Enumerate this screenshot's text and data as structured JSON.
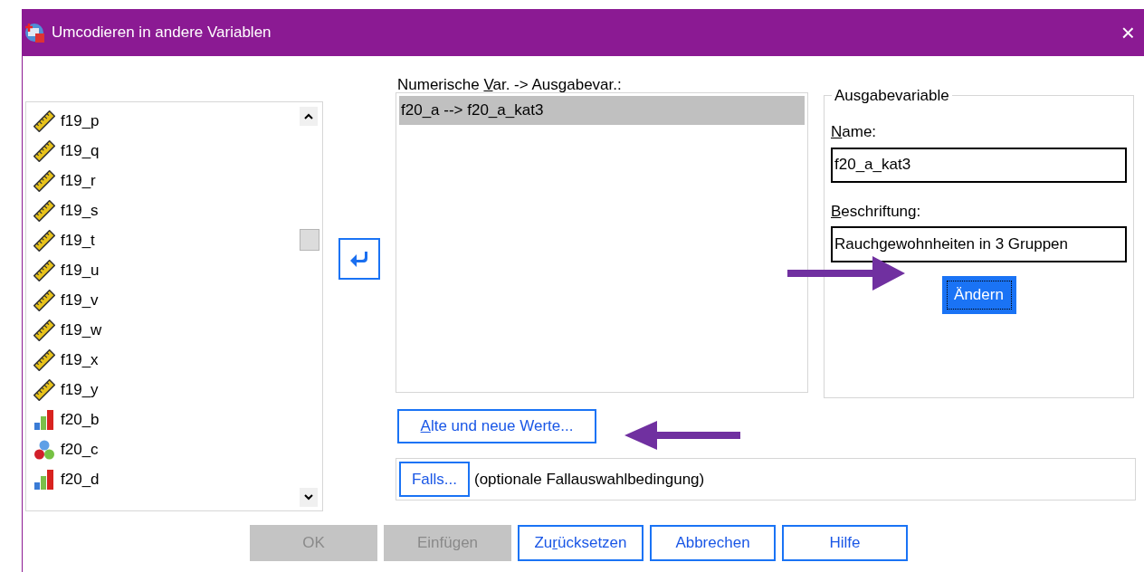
{
  "window": {
    "title": "Umcodieren in andere Variablen",
    "close": "×"
  },
  "variables": [
    {
      "name": "f19_p",
      "kind": "scale"
    },
    {
      "name": "f19_q",
      "kind": "scale"
    },
    {
      "name": "f19_r",
      "kind": "scale"
    },
    {
      "name": "f19_s",
      "kind": "scale"
    },
    {
      "name": "f19_t",
      "kind": "scale"
    },
    {
      "name": "f19_u",
      "kind": "scale"
    },
    {
      "name": "f19_v",
      "kind": "scale"
    },
    {
      "name": "f19_w",
      "kind": "scale"
    },
    {
      "name": "f19_x",
      "kind": "scale"
    },
    {
      "name": "f19_y",
      "kind": "scale"
    },
    {
      "name": "f20_b",
      "kind": "ordinal"
    },
    {
      "name": "f20_c",
      "kind": "nominal"
    },
    {
      "name": "f20_d",
      "kind": "ordinal"
    }
  ],
  "mapping": {
    "label": [
      {
        "text": "Numerische ",
        "underlined": false
      },
      {
        "text": "V",
        "underlined": true
      },
      {
        "text": "ar. -> Ausgabevar.:",
        "underlined": false
      }
    ],
    "items": [
      {
        "text": "f20_a --> f20_a_kat3",
        "selected": true
      }
    ]
  },
  "output_variable": {
    "legend": "Ausgabevariable",
    "name_label": [
      {
        "text": "N",
        "underlined": true
      },
      {
        "text": "ame:",
        "underlined": false
      }
    ],
    "name_value": "f20_a_kat3",
    "label_label": [
      {
        "text": "B",
        "underlined": true
      },
      {
        "text": "eschriftung:",
        "underlined": false
      }
    ],
    "label_value": "Rauchgewohnheiten in 3 Gruppen",
    "change_button": "Ändern"
  },
  "old_new_button": {
    "label": [
      {
        "text": "A",
        "underlined": true
      },
      {
        "text": "lte und neue Werte...",
        "underlined": false
      }
    ]
  },
  "condition": {
    "button": "Falls...",
    "text": "(optionale Fallauswahlbedingung)"
  },
  "buttons": [
    {
      "label": [
        {
          "text": "OK",
          "underlined": false
        }
      ],
      "disabled": true
    },
    {
      "label": [
        {
          "text": "Einfügen",
          "underlined": false
        }
      ],
      "disabled": true
    },
    {
      "label": [
        {
          "text": "Zu",
          "underlined": false
        },
        {
          "text": "r",
          "underlined": true
        },
        {
          "text": "ücksetzen",
          "underlined": false
        }
      ],
      "disabled": false
    },
    {
      "label": [
        {
          "text": "Abbrechen",
          "underlined": false
        }
      ],
      "disabled": false
    },
    {
      "label": [
        {
          "text": "Hilfe",
          "underlined": false
        }
      ],
      "disabled": false
    }
  ]
}
